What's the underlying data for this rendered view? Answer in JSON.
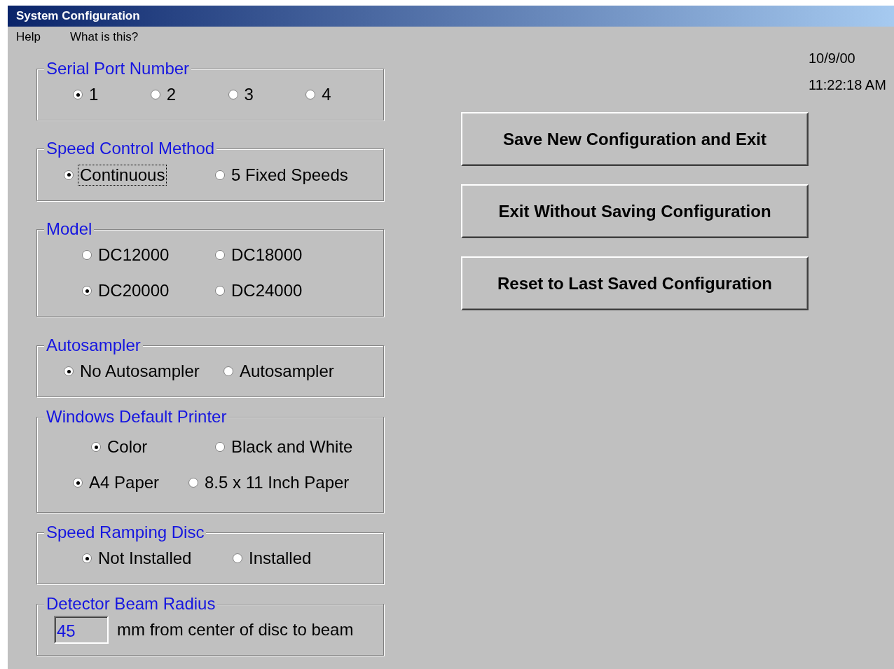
{
  "window": {
    "title": "System Configuration"
  },
  "menu": [
    {
      "label": "Help"
    },
    {
      "label": "What is this?"
    }
  ],
  "groups": [
    {
      "title": "Serial Port Number",
      "kind": "radio",
      "rows": [
        [
          {
            "label": "1",
            "selected": true,
            "focused": false
          },
          {
            "label": "2",
            "selected": false,
            "focused": false
          },
          {
            "label": "3",
            "selected": false,
            "focused": false
          },
          {
            "label": "4",
            "selected": false,
            "focused": false
          }
        ]
      ]
    },
    {
      "title": "Speed Control Method",
      "kind": "radio",
      "rows": [
        [
          {
            "label": "Continuous",
            "selected": true,
            "focused": true
          },
          {
            "label": "5 Fixed Speeds",
            "selected": false,
            "focused": false
          }
        ]
      ]
    },
    {
      "title": "Model",
      "kind": "radio",
      "rows": [
        [
          {
            "label": "DC12000",
            "selected": false,
            "focused": false
          },
          {
            "label": "DC18000",
            "selected": false,
            "focused": false
          }
        ],
        [
          {
            "label": "DC20000",
            "selected": true,
            "focused": false
          },
          {
            "label": "DC24000",
            "selected": false,
            "focused": false
          }
        ]
      ]
    },
    {
      "title": "Autosampler",
      "kind": "radio",
      "rows": [
        [
          {
            "label": "No Autosampler",
            "selected": true,
            "focused": false
          },
          {
            "label": "Autosampler",
            "selected": false,
            "focused": false
          }
        ]
      ]
    },
    {
      "title": "Windows Default Printer",
      "kind": "radio",
      "rows": [
        [
          {
            "label": "Color",
            "selected": true,
            "focused": false
          },
          {
            "label": "Black and White",
            "selected": false,
            "focused": false
          }
        ],
        [
          {
            "label": "A4 Paper",
            "selected": true,
            "focused": false
          },
          {
            "label": "8.5 x 11 Inch Paper",
            "selected": false,
            "focused": false
          }
        ]
      ]
    },
    {
      "title": "Speed Ramping Disc",
      "kind": "radio",
      "rows": [
        [
          {
            "label": "Not Installed",
            "selected": true,
            "focused": false
          },
          {
            "label": "Installed",
            "selected": false,
            "focused": false
          }
        ]
      ]
    },
    {
      "title": "Detector Beam Radius",
      "kind": "field",
      "value": "45",
      "caption": "mm from center of disc to beam"
    }
  ],
  "buttons": [
    {
      "label": "Save New Configuration and Exit"
    },
    {
      "label": "Exit Without Saving Configuration"
    },
    {
      "label": "Reset to Last Saved Configuration"
    }
  ],
  "date": "10/9/00",
  "time": "11:22:18 AM"
}
